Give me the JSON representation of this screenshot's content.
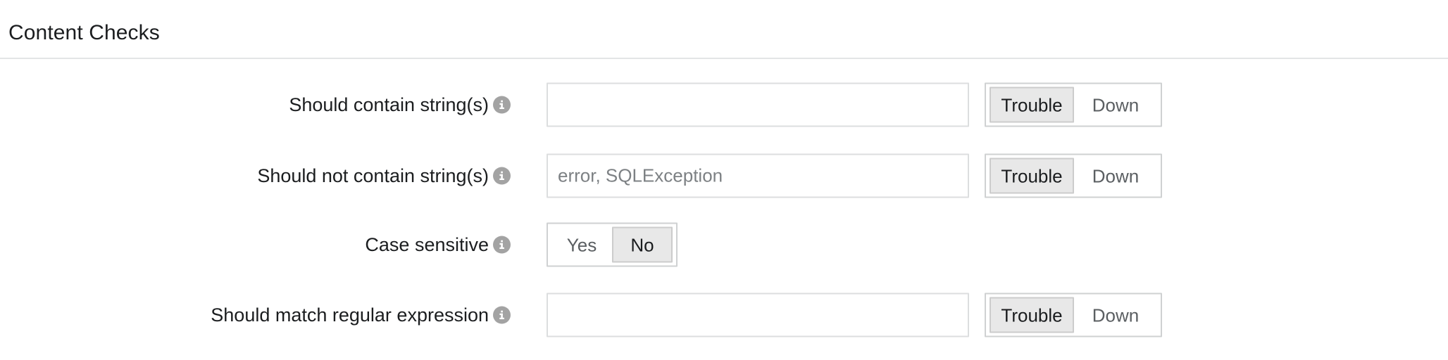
{
  "panel": {
    "title": "Content Checks"
  },
  "icons": {
    "info": "info-icon"
  },
  "rows": [
    {
      "id": "should-contain",
      "label": "Should contain string(s)",
      "input": {
        "value": "",
        "placeholder": ""
      },
      "control": "severity",
      "options": [
        "Trouble",
        "Down"
      ],
      "selected": "Trouble"
    },
    {
      "id": "should-not-contain",
      "label": "Should not contain string(s)",
      "input": {
        "value": "",
        "placeholder": "error, SQLException"
      },
      "control": "severity",
      "options": [
        "Trouble",
        "Down"
      ],
      "selected": "Trouble"
    },
    {
      "id": "case-sensitive",
      "label": "Case sensitive",
      "input": null,
      "control": "yesno",
      "options": [
        "Yes",
        "No"
      ],
      "selected": "No"
    },
    {
      "id": "should-match-regex",
      "label": "Should match regular expression",
      "input": {
        "value": "",
        "placeholder": ""
      },
      "control": "severity",
      "options": [
        "Trouble",
        "Down"
      ],
      "selected": "Trouble"
    }
  ],
  "colors": {
    "text": "#1b1d1f",
    "muted": "#7d8184",
    "divider": "#e3e5e6",
    "input_border": "#dcdedf",
    "group_border": "#cfd1d2",
    "selected_bg": "#e8e8e8",
    "info_icon_bg": "#a3a3a3"
  }
}
